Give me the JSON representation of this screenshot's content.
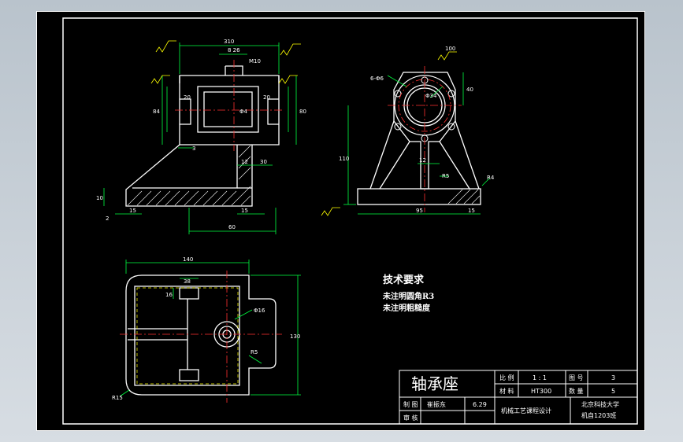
{
  "drawing": {
    "title": "轴承座",
    "dimensions": {
      "front": [
        "310",
        "8 26",
        "M10",
        "20",
        "20",
        "84",
        "80",
        "Φ4",
        "3",
        "12",
        "30",
        "10",
        "2",
        "15",
        "15",
        "60"
      ],
      "side": [
        "6-Φ6",
        "Φ34",
        "40",
        "110",
        "12",
        "R5",
        "R4",
        "95",
        "15",
        "100"
      ],
      "top": [
        "140",
        "38",
        "16",
        "Φ16",
        "R5",
        "R15",
        "130"
      ]
    },
    "technical_requirements": {
      "heading": "技术要求",
      "lines": [
        "未注明圆角R3",
        "未注明粗糙度"
      ]
    },
    "title_block": {
      "scale_label": "比 例",
      "scale_value": "1 : 1",
      "drawing_no_label": "图 号",
      "drawing_no_value": "3",
      "material_label": "材 料",
      "material_value": "HT300",
      "quantity_label": "数 量",
      "quantity_value": "5",
      "drawn_label": "制 图",
      "drawn_name": "崔振东",
      "drawn_date": "6.29",
      "checked_label": "审 核",
      "course": "机械工艺课程设计",
      "school": "北京科技大学",
      "class": "机自1203班"
    }
  }
}
